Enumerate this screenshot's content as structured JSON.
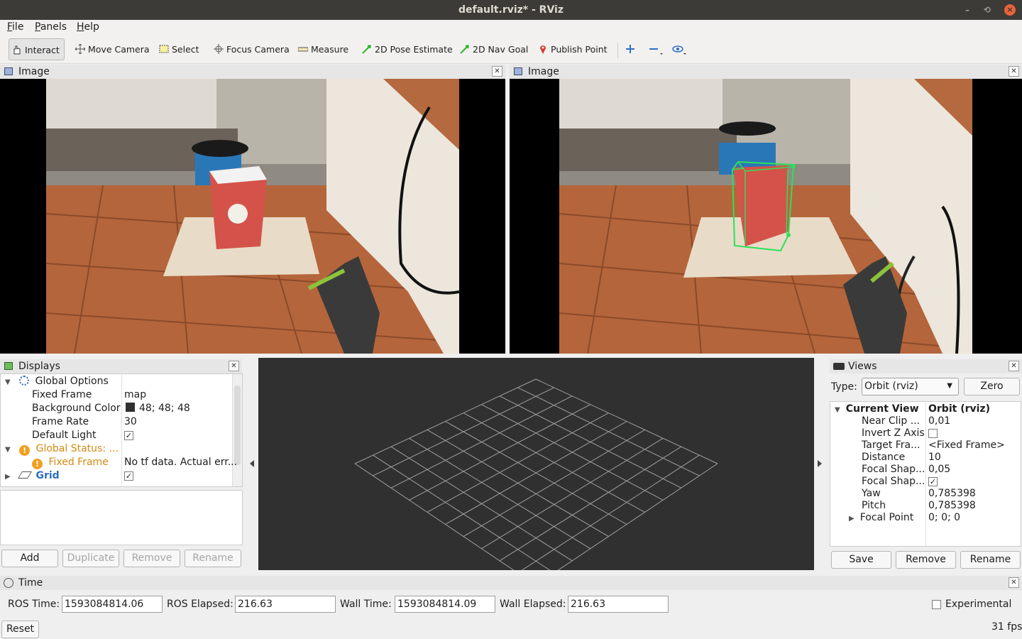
{
  "window": {
    "title": "default.rviz* - RViz",
    "minimize": "–",
    "maximize": "⟲",
    "close": "×"
  },
  "menu": [
    "File",
    "Panels",
    "Help"
  ],
  "toolbar": {
    "interact": "Interact",
    "move_camera": "Move Camera",
    "select": "Select",
    "focus_camera": "Focus Camera",
    "measure": "Measure",
    "pose_estimate": "2D Pose Estimate",
    "nav_goal": "2D Nav Goal",
    "publish_point": "Publish Point"
  },
  "image_panels": [
    {
      "title": "Image"
    },
    {
      "title": "Image"
    }
  ],
  "displays": {
    "title": "Displays",
    "rows": [
      {
        "name": "Global Options",
        "value": ""
      },
      {
        "name": "Fixed Frame",
        "value": "map"
      },
      {
        "name": "Background Color",
        "value": "48; 48; 48"
      },
      {
        "name": "Frame Rate",
        "value": "30"
      },
      {
        "name": "Default Light",
        "value": "✓"
      },
      {
        "name": "Global Status: ...",
        "value": ""
      },
      {
        "name": "Fixed Frame",
        "value": "No tf data.  Actual err..."
      },
      {
        "name": "Grid",
        "value": "✓"
      }
    ],
    "buttons": {
      "add": "Add",
      "duplicate": "Duplicate",
      "remove": "Remove",
      "rename": "Rename"
    }
  },
  "views": {
    "title": "Views",
    "type_label": "Type:",
    "type_value": "Orbit (rviz)",
    "zero": "Zero",
    "header_name": "Current View",
    "header_value": "Orbit (rviz)",
    "rows": [
      {
        "name": "Near Clip ...",
        "value": "0,01"
      },
      {
        "name": "Invert Z Axis",
        "value": ""
      },
      {
        "name": "Target Fra...",
        "value": "<Fixed Frame>"
      },
      {
        "name": "Distance",
        "value": "10"
      },
      {
        "name": "Focal Shap...",
        "value": "0,05"
      },
      {
        "name": "Focal Shap...",
        "value": "✓"
      },
      {
        "name": "Yaw",
        "value": "0,785398"
      },
      {
        "name": "Pitch",
        "value": "0,785398"
      },
      {
        "name": "Focal Point",
        "value": "0; 0; 0"
      }
    ],
    "buttons": {
      "save": "Save",
      "remove": "Remove",
      "rename": "Rename"
    }
  },
  "time": {
    "title": "Time",
    "ros_time_label": "ROS Time:",
    "ros_time": "1593084814.06",
    "ros_elapsed_label": "ROS Elapsed:",
    "ros_elapsed": "216.63",
    "wall_time_label": "Wall Time:",
    "wall_time": "1593084814.09",
    "wall_elapsed_label": "Wall Elapsed:",
    "wall_elapsed": "216.63",
    "experimental": "Experimental",
    "reset": "Reset",
    "fps": "31 fps"
  },
  "colors": {
    "viewport_bg": "#303030",
    "grid_line": "#a0a0a0",
    "bbox": "#2ee05a",
    "warning": "#e6a01e",
    "grid_label": "#2a6fc0"
  }
}
